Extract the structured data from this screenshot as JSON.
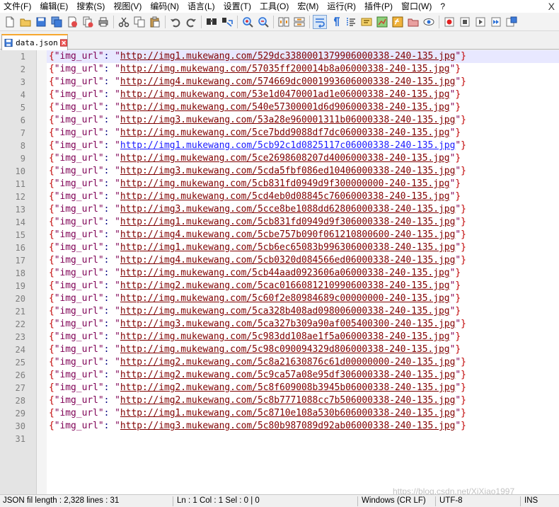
{
  "menubar": {
    "items": [
      "文件(F)",
      "编辑(E)",
      "搜索(S)",
      "视图(V)",
      "编码(N)",
      "语言(L)",
      "设置(T)",
      "工具(O)",
      "宏(M)",
      "运行(R)",
      "插件(P)",
      "窗口(W)",
      "?"
    ],
    "close_label": "X"
  },
  "toolbar": {
    "icons": [
      "new-file-icon",
      "open-file-icon",
      "save-icon",
      "save-all-icon",
      "close-icon",
      "close-all-icon",
      "print-icon",
      "cut-icon",
      "copy-icon",
      "paste-icon",
      "undo-icon",
      "redo-icon",
      "find-icon",
      "replace-icon",
      "zoom-in-icon",
      "zoom-out-icon",
      "sync-vertical-icon",
      "sync-horizontal-icon",
      "word-wrap-icon",
      "show-all-chars-icon",
      "indent-guide-icon",
      "language-icon",
      "doc-map-icon",
      "function-list-icon",
      "folder-workspace-icon",
      "monitor-icon",
      "record-macro-icon",
      "stop-record-icon",
      "play-macro-icon",
      "run-macro-multiple-icon",
      "save-macro-icon"
    ]
  },
  "tabs": [
    {
      "label": "data.json",
      "active": true
    }
  ],
  "editor": {
    "current_line": 1,
    "json_key": "\"img_url\"",
    "lines": [
      "http://img1.mukewang.com/529dc3380001379906000338-240-135.jpg",
      "http://img.mukewang.com/57035ff200014b8a06000338-240-135.jpg",
      "http://img4.mukewang.com/574669dc0001993606000338-240-135.jpg",
      "http://img.mukewang.com/53e1d0470001ad1e06000338-240-135.jpg",
      "http://img.mukewang.com/540e57300001d6d906000338-240-135.jpg",
      "http://img3.mukewang.com/53a28e960001311b06000338-240-135.jpg",
      "http://img.mukewang.com/5ce7bdd9088df7dc06000338-240-135.jpg",
      "http://img1.mukewang.com/5cb92c1d0825117c06000338-240-135.jpg",
      "http://img.mukewang.com/5ce2698608207d4006000338-240-135.jpg",
      "http://img3.mukewang.com/5cda5fbf086ed10406000338-240-135.jpg",
      "http://img.mukewang.com/5cb831fd0949d9f300000000-240-135.jpg",
      "http://img.mukewang.com/5cd4eb0d08845c7606000338-240-135.jpg",
      "http://img3.mukewang.com/5cce8be1088dd62806000338-240-135.jpg",
      "http://img1.mukewang.com/5cb831fd0949d9f306000338-240-135.jpg",
      "http://img4.mukewang.com/5cbe757b090f061210800600-240-135.jpg",
      "http://img1.mukewang.com/5cb6ec65083b996306000338-240-135.jpg",
      "http://img4.mukewang.com/5cb0320d084566ed06000338-240-135.jpg",
      "http://img.mukewang.com/5cb44aad0923606a06000338-240-135.jpg",
      "http://img2.mukewang.com/5cac0166081210990600338-240-135.jpg",
      "http://img.mukewang.com/5c60f2e80984689c00000000-240-135.jpg",
      "http://img.mukewang.com/5ca328b408ad098006000338-240-135.jpg",
      "http://img3.mukewang.com/5ca327b309a90af005400300-240-135.jpg",
      "http://img.mukewang.com/5c983dd108ae1f5a06000338-240-135.jpg",
      "http://img.mukewang.com/5c98c090094329d806000338-240-135.jpg",
      "http://img2.mukewang.com/5c8a21630876c61d00000000-240-135.jpg",
      "http://img2.mukewang.com/5c9ca57a08e95df306000338-240-135.jpg",
      "http://img2.mukewang.com/5c8f609008b3945b06000338-240-135.jpg",
      "http://img2.mukewang.com/5c8b7771088cc7b506000338-240-135.jpg",
      "http://img1.mukewang.com/5c8710e108a530b606000338-240-135.jpg",
      "http://img3.mukewang.com/5c80b987089d92ab06000338-240-135.jpg"
    ],
    "hot_line": 8,
    "total_line_numbers": 31
  },
  "statusbar": {
    "file_info": "JSON fil length : 2,328    lines : 31",
    "position": "Ln : 1    Col : 1    Sel : 0 | 0",
    "eol": "Windows (CR LF)",
    "encoding": "UTF-8",
    "mode": "INS"
  },
  "watermark": "https://blog.csdn.net/XiXiao1997"
}
